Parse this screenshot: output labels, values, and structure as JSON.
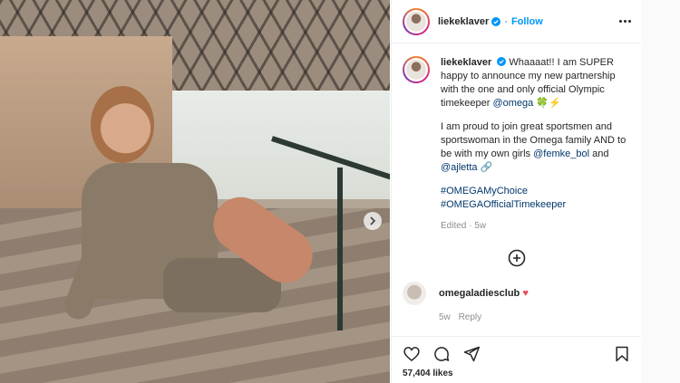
{
  "post": {
    "username": "liekeklaver",
    "follow_label": "Follow",
    "caption": {
      "lines1": "Whaaaat!! I am SUPER happy to announce my new partnership with the one and only official Olympic timekeeper",
      "mention_omega": "@omega",
      "emojis": "🍀⚡",
      "lines2": "I am proud to join great sportsmen and sportswoman in the Omega family AND to be with my own girls",
      "mention_femke": "@femke_bol",
      "and": "and",
      "mention_ajletta": "@ajletta",
      "link_emoji": "🔗",
      "hashtag1": "#OMEGAMyChoice",
      "hashtag2": "#OMEGAOfficialTimekeeper"
    },
    "edited": "Edited",
    "edited_time": "5w",
    "separator": "·"
  },
  "comments": [
    {
      "username": "omegaladiesclub",
      "emoji": "♥",
      "time": "5w",
      "reply_label": "Reply"
    }
  ],
  "footer": {
    "likes_text": "57,404 likes"
  },
  "icons": {
    "like": "heart-icon",
    "comment": "comment-icon",
    "share": "share-icon",
    "save": "bookmark-icon",
    "more": "more-icon",
    "add": "add-circle-icon",
    "next": "chevron-right-icon",
    "verified": "verified-badge-icon"
  },
  "colors": {
    "accent": "#0095f6",
    "link": "#00376b",
    "heart_emoji": "#ed4956"
  }
}
